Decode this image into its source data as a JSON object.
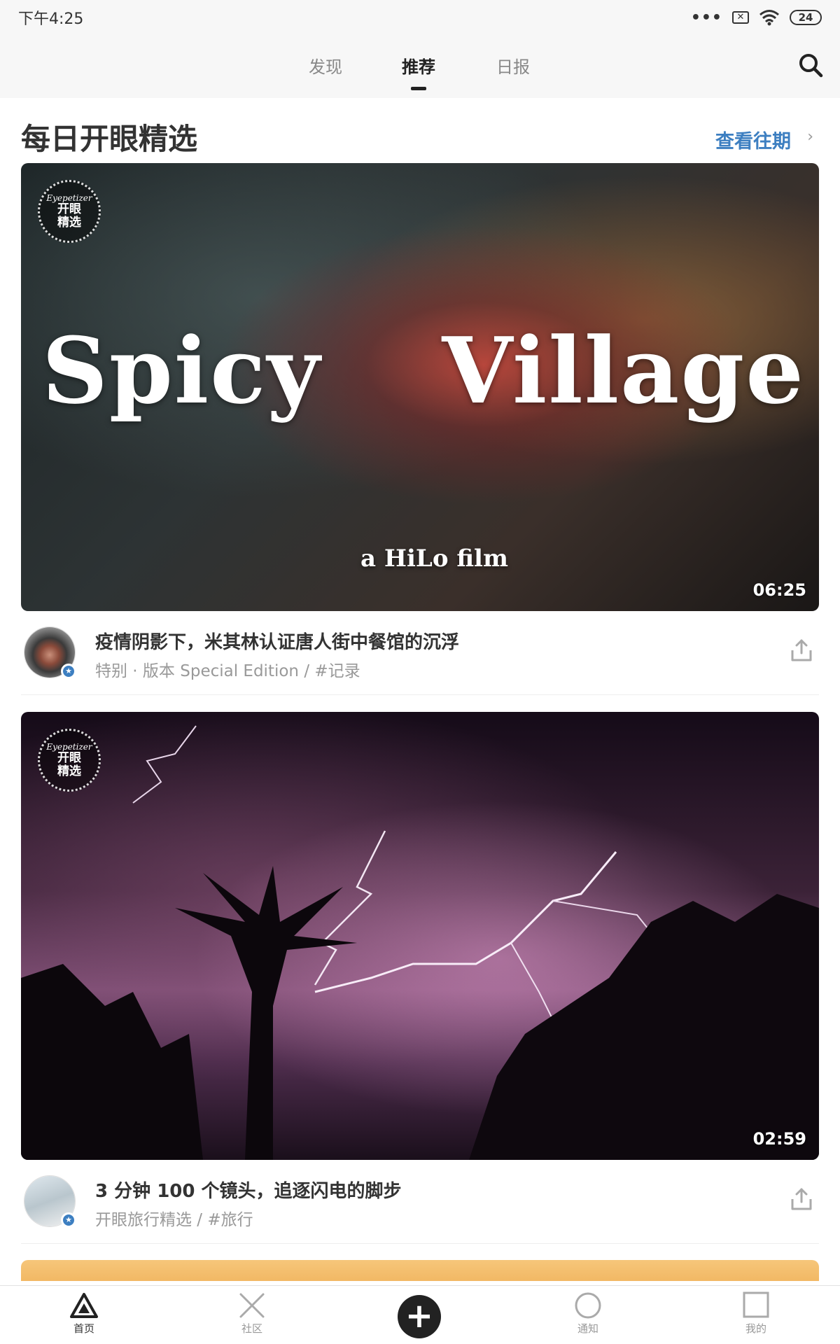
{
  "status_bar": {
    "time": "下午4:25",
    "dots": "•••",
    "sim": "✕",
    "battery": "24"
  },
  "tabs": [
    {
      "label": "发现",
      "active": false
    },
    {
      "label": "推荐",
      "active": true
    },
    {
      "label": "日报",
      "active": false
    }
  ],
  "section": {
    "title": "每日开眼精选",
    "past_link": "查看往期",
    "chevron": "›"
  },
  "badge": {
    "brand": "Eyepetizer",
    "line1": "开眼",
    "line2": "精选"
  },
  "cards": [
    {
      "overlay_word1": "Spicy",
      "overlay_word2": "Village",
      "overlay_credit": "a HiLo film",
      "duration": "06:25",
      "title": "疫情阴影下，米其林认证唐人街中餐馆的沉浮",
      "meta": "特别 · 版本 Special Edition  /  #记录"
    },
    {
      "duration": "02:59",
      "title": "3 分钟 100 个镜头，追逐闪电的脚步",
      "meta": "开眼旅行精选  /  #旅行"
    }
  ],
  "bottom_nav": [
    {
      "label": "首页",
      "icon": "triangle-icon",
      "active": true
    },
    {
      "label": "社区",
      "icon": "cross-icon",
      "active": false
    },
    {
      "label": "+",
      "icon": "plus-icon",
      "active": false
    },
    {
      "label": "通知",
      "icon": "circle-icon",
      "active": false
    },
    {
      "label": "我的",
      "icon": "square-icon",
      "active": false
    }
  ],
  "colors": {
    "accent": "#3d7fc1",
    "text": "#333333",
    "muted": "#999999"
  }
}
